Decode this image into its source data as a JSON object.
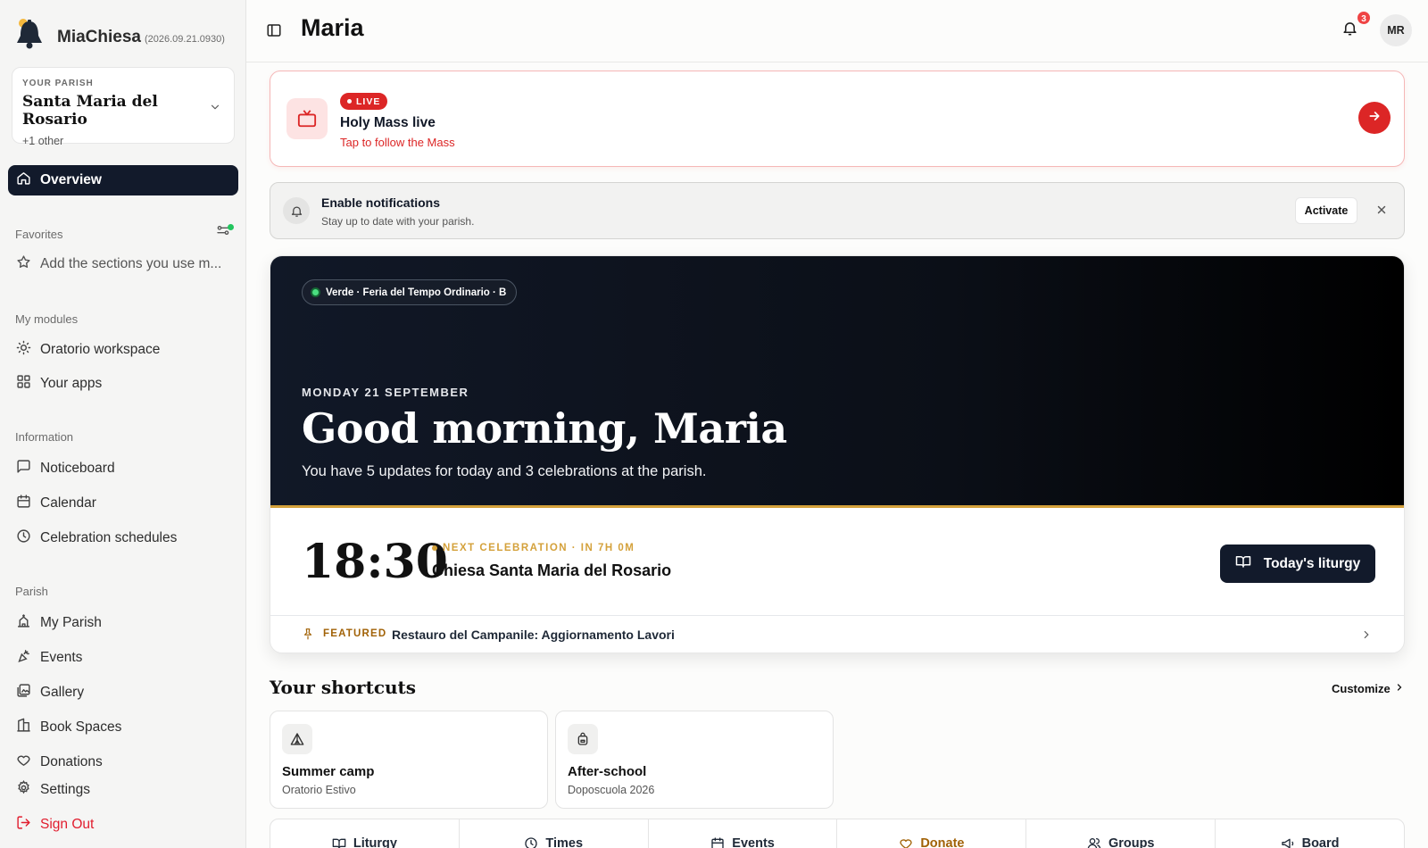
{
  "app": {
    "name": "MiaChiesa",
    "version": "(2026.09.21.0930)"
  },
  "parish": {
    "label": "YOUR PARISH",
    "name": "Santa Maria del Rosario",
    "other": "+1 other"
  },
  "sidebar": {
    "overview": "Overview",
    "favorites_label": "Favorites",
    "favorites_hint": "Add the sections you use m...",
    "modules_label": "My modules",
    "modules": [
      "Oratorio workspace",
      "Your apps"
    ],
    "information_label": "Information",
    "information": [
      "Noticeboard",
      "Calendar",
      "Celebration schedules"
    ],
    "parish_label": "Parish",
    "parish_items": [
      "My Parish",
      "Events",
      "Gallery",
      "Book Spaces",
      "Donations"
    ],
    "settings": "Settings",
    "sign_out": "Sign Out"
  },
  "header": {
    "title": "Maria",
    "notification_count": "3",
    "avatar_initials": "MR"
  },
  "live": {
    "badge": "LIVE",
    "title": "Holy Mass live",
    "subtitle": "Tap to follow the Mass"
  },
  "notifications_prompt": {
    "title": "Enable notifications",
    "subtitle": "Stay up to date with your parish.",
    "button": "Activate"
  },
  "hero": {
    "season": "Verde · Feria del Tempo Ordinario · B",
    "date": "MONDAY 21 SEPTEMBER",
    "greeting": "Good morning, Maria",
    "summary": "You have 5 updates for today and 3 celebrations at the parish."
  },
  "next_celebration": {
    "time": "18:30",
    "label": "NEXT CELEBRATION · IN 7H 0M",
    "place": "Chiesa Santa Maria del Rosario",
    "button": "Today's liturgy"
  },
  "featured": {
    "label": "FEATURED",
    "text": "Restauro del Campanile: Aggiornamento Lavori"
  },
  "shortcuts": {
    "title": "Your shortcuts",
    "customize": "Customize",
    "items": [
      {
        "name": "Summer camp",
        "sub": "Oratorio Estivo",
        "icon": "tent-icon"
      },
      {
        "name": "After-school",
        "sub": "Doposcuola 2026",
        "icon": "backpack-icon"
      }
    ]
  },
  "quick_actions": [
    "Liturgy",
    "Times",
    "Events",
    "Donate",
    "Groups",
    "Board"
  ],
  "colors": {
    "accent_dark": "#121a2b",
    "live_red": "#dc2626",
    "gold": "#d4a13b"
  }
}
